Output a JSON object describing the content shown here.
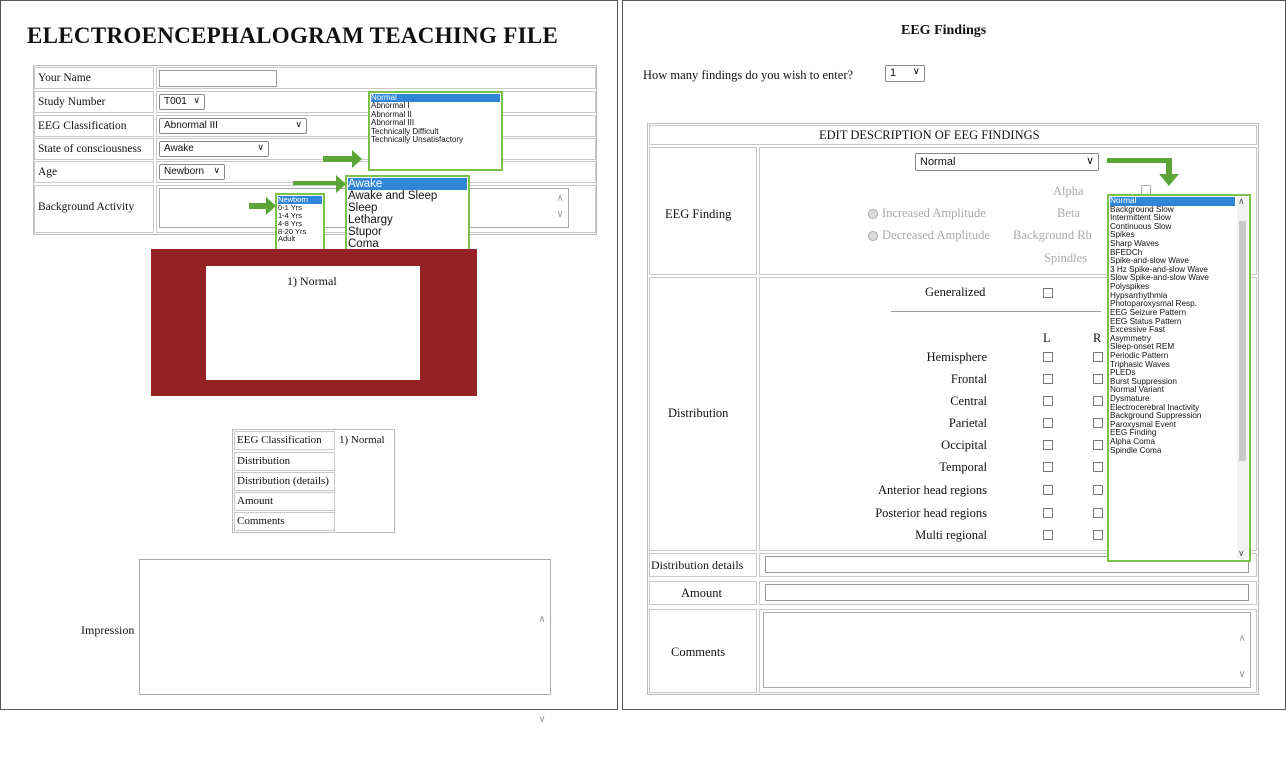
{
  "left": {
    "title": "ELECTROENCEPHALOGRAM TEACHING FILE",
    "form": {
      "your_name_label": "Your Name",
      "your_name_value": "",
      "study_number_label": "Study Number",
      "study_number_value": "T001",
      "eeg_class_label": "EEG Classification",
      "eeg_class_value": "Abnormal III",
      "consciousness_label": "State of consciousness",
      "consciousness_value": "Awake",
      "age_label": "Age",
      "age_value": "Newborn",
      "background_label": "Background Activity"
    },
    "classification_options": [
      "Normal",
      "Abnormal I",
      "Abnormal II",
      "Abnormal III",
      "Technically Difficult",
      "Technically Unsatisfactory"
    ],
    "consciousness_options": [
      "Awake",
      "Awake and Sleep",
      "Sleep",
      "Lethargy",
      "Stupor",
      "Coma"
    ],
    "age_options": [
      "Newborn",
      "0-1 Yrs",
      "1-4 Yrs",
      "4-8 Yrs",
      "8-20 Yrs",
      "Adult"
    ],
    "finding_caption": "1) Normal",
    "summary": {
      "rows": [
        {
          "label": "EEG Classification",
          "value": "1) Normal"
        },
        {
          "label": "Distribution",
          "value": ""
        },
        {
          "label": "Distribution (details)",
          "value": ""
        },
        {
          "label": "Amount",
          "value": ""
        },
        {
          "label": "Comments",
          "value": ""
        }
      ]
    },
    "impression_label": "Impression",
    "colors": {
      "maroon": "#962124",
      "highlight": "#2f86d8",
      "callout_green": "#7cc24a"
    }
  },
  "right": {
    "title": "EEG Findings",
    "how_many_label": "How many findings do you wish to enter?",
    "how_many_value": "1",
    "section_header": "EDIT DESCRIPTION OF EEG FINDINGS",
    "eeg_finding_label": "EEG Finding",
    "eeg_finding_value": "Normal",
    "amplitude": [
      "Increased Amplitude",
      "Decreased Amplitude"
    ],
    "rhythms": [
      "Alpha",
      "Beta",
      "Background Rh",
      "Spindles"
    ],
    "distribution_label": "Distribution",
    "generalized_label": "Generalized",
    "l_label": "L",
    "r_label": "R",
    "regions": [
      "Hemisphere",
      "Frontal",
      "Central",
      "Parietal",
      "Occipital",
      "Temporal",
      "Anterior head regions",
      "Posterior head regions",
      "Multi regional"
    ],
    "distribution_details_label": "Distribution details",
    "amount_label": "Amount",
    "comments_label": "Comments",
    "finding_options": [
      "Normal",
      "Background Slow",
      "Intermittent Slow",
      "Continuous Slow",
      "Spikes",
      "Sharp Waves",
      "BFEDCh",
      "Spike-and-slow Wave",
      "3 Hz Spike-and-slow Wave",
      "Slow Spike-and-slow Wave",
      "Polyspikes",
      "Hypsarrhythmia",
      "Photoparoxysmal Resp.",
      "EEG Seizure Pattern",
      "EEG Status Pattern",
      "Excessive Fast",
      "Asymmetry",
      "Sleep-onset REM",
      "Periodic Pattern",
      "Triphasic Waves",
      "PLEDs",
      "Burst Suppression",
      "Normal Variant",
      "Dysmature",
      "Electrocerebral Inactivity",
      "Background Suppression",
      "Paroxysmal Event",
      "EEG Finding",
      "Alpha Coma",
      "Spindle Coma"
    ]
  }
}
